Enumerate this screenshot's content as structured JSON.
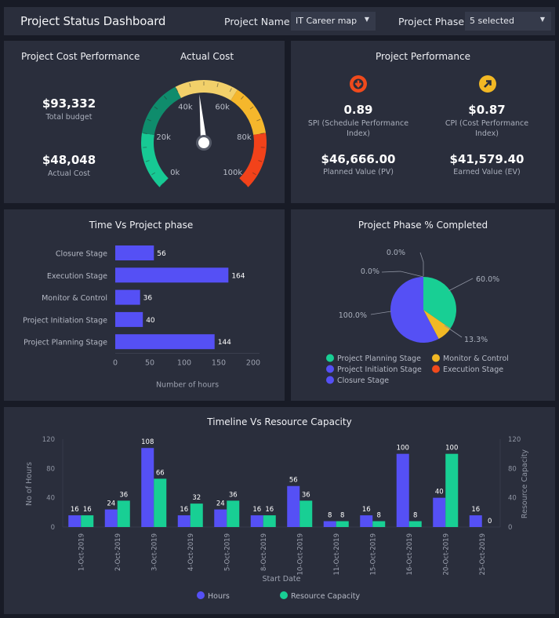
{
  "header": {
    "title": "Project Status Dashboard",
    "project_name_label": "Project Name",
    "project_name_value": "IT Career map",
    "project_phase_label": "Project Phase",
    "project_phase_value": "5 selected"
  },
  "cost_performance": {
    "title": "Project Cost Performance",
    "total_budget_value": "$93,332",
    "total_budget_label": "Total budget",
    "actual_cost_value": "$48,048",
    "actual_cost_label": "Actual Cost"
  },
  "gauge": {
    "title": "Actual Cost",
    "min": 0,
    "max": 100000,
    "value": 48048,
    "tick_labels": [
      "0k",
      "20k",
      "40k",
      "60k",
      "80k",
      "100k"
    ],
    "bands": [
      {
        "from": 0,
        "to": 20000,
        "color": "#17c994"
      },
      {
        "from": 20000,
        "to": 40000,
        "color": "#0f8c6c"
      },
      {
        "from": 40000,
        "to": 62000,
        "color": "#f2d06a"
      },
      {
        "from": 62000,
        "to": 80000,
        "color": "#f5b72c"
      },
      {
        "from": 80000,
        "to": 100000,
        "color": "#f2421a"
      }
    ]
  },
  "performance": {
    "title": "Project Performance",
    "spi": {
      "value": "0.89",
      "label_line1": "SPI (Schedule Performance",
      "label_line2": "Index)",
      "icon": "arrow-down-icon",
      "color": "#f04a1c"
    },
    "cpi": {
      "value": "$0.87",
      "label_line1": "CPI (Cost Performance",
      "label_line2": "Index)",
      "icon": "arrow-up-right-icon",
      "color": "#f2b824"
    },
    "pv": {
      "value": "$46,666.00",
      "label": "Planned Value (PV)"
    },
    "ev": {
      "value": "$41,579.40",
      "label": "Earned Value (EV)"
    }
  },
  "colors": {
    "hours": "#5550f5",
    "capacity": "#18cf94",
    "monitor": "#f2b824",
    "execution": "#f04a1c"
  },
  "chart_data": [
    {
      "type": "bar",
      "orientation": "horizontal",
      "title": "Time Vs Project phase",
      "categories": [
        "Closure Stage",
        "Execution Stage",
        "Monitor & Control",
        "Project Initiation Stage",
        "Project Planning Stage"
      ],
      "values": [
        56,
        164,
        36,
        40,
        144
      ],
      "xlabel": "Number of hours",
      "ylabel": "",
      "xlim": [
        0,
        200
      ],
      "xticks": [
        "0",
        "50",
        "100",
        "150",
        "200"
      ],
      "grid": false
    },
    {
      "type": "pie",
      "title": "Project Phase % Completed",
      "slices": [
        {
          "label": "Project Planning Stage",
          "value": 60.0,
          "display": "60.0%",
          "color": "#18cf94"
        },
        {
          "label": "Monitor & Control",
          "value": 13.3,
          "display": "13.3%",
          "color": "#f2b824"
        },
        {
          "label": "Closure Stage",
          "value": 100.0,
          "display": "100.0%",
          "color": "#5550f5"
        },
        {
          "label": "Project Initiation Stage",
          "value": 0.0,
          "display": "0.0%",
          "color": "#5550f5"
        },
        {
          "label": "Execution Stage",
          "value": 0.0,
          "display": "0.0%",
          "color": "#f04a1c"
        }
      ],
      "legend": [
        {
          "label": "Project Planning Stage",
          "color": "#18cf94"
        },
        {
          "label": "Monitor & Control",
          "color": "#f2b824"
        },
        {
          "label": "Project Initiation Stage",
          "color": "#5550f5"
        },
        {
          "label": "Execution Stage",
          "color": "#f04a1c"
        },
        {
          "label": "Closure Stage",
          "color": "#5550f5"
        }
      ],
      "legend_position": "bottom"
    },
    {
      "type": "bar",
      "title": "Timeline Vs Resource Capacity",
      "categories": [
        "1-Oct-2019",
        "2-Oct-2019",
        "3-Oct-2019",
        "4-Oct-2019",
        "5-Oct-2019",
        "8-Oct-2019",
        "10-Oct-2019",
        "11-Oct-2019",
        "15-Oct-2019",
        "16-Oct-2019",
        "20-Oct-2019",
        "25-Oct-2019"
      ],
      "series": [
        {
          "name": "Hours",
          "values": [
            16,
            24,
            108,
            16,
            24,
            16,
            56,
            8,
            16,
            100,
            40,
            16
          ],
          "color": "#5550f5"
        },
        {
          "name": "Resource Capacity",
          "values": [
            16,
            36,
            66,
            32,
            36,
            16,
            36,
            8,
            8,
            8,
            100,
            0
          ],
          "color": "#18cf94"
        }
      ],
      "xlabel": "Start Date",
      "ylabel": "No of Hours",
      "y2label": "Resource Capacity",
      "ylim": [
        0,
        120
      ],
      "y2lim": [
        0,
        120
      ],
      "yticks": [
        "0",
        "40",
        "80",
        "120"
      ],
      "legend_position": "bottom"
    }
  ]
}
